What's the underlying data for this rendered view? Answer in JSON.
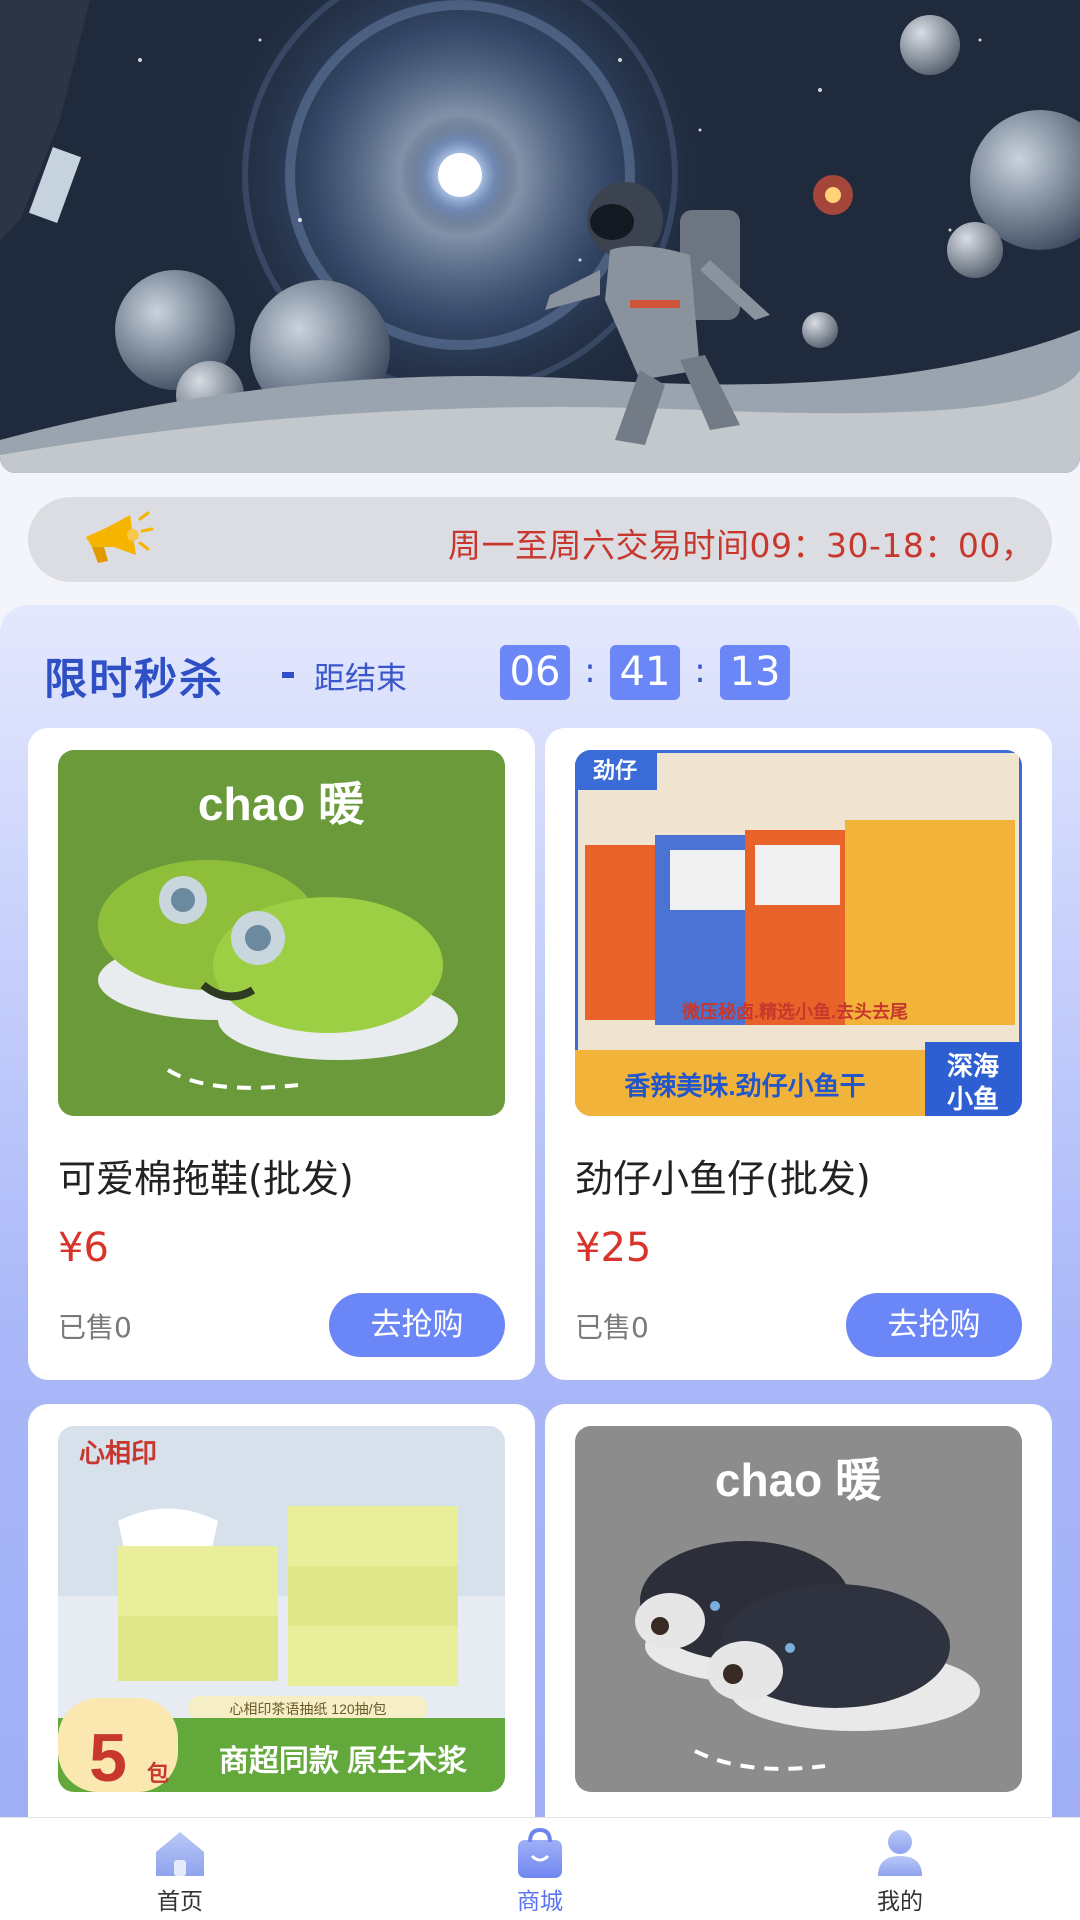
{
  "notice": {
    "text": "周一至周六交易时间09：30-18：00，",
    "speaker_icon": "megaphone-icon"
  },
  "flash_sale": {
    "title": "限时秒杀",
    "subtitle": "距结束",
    "countdown": {
      "hours": "06",
      "minutes": "41",
      "seconds": "13",
      "separator": ":"
    }
  },
  "products": [
    {
      "name": "可爱棉拖鞋(批发)",
      "price": "¥6",
      "sold": "已售0",
      "button": "去抢购",
      "image_text": {
        "brand": "chao 暖"
      }
    },
    {
      "name": "劲仔小鱼仔(批发)",
      "price": "¥25",
      "sold": "已售0",
      "button": "去抢购",
      "image_text": {
        "logo": "劲仔",
        "line1": "微压秘卤.精选小鱼.去头去尾",
        "line2": "香辣美味.劲仔小鱼干",
        "badge1": "深海",
        "badge2": "小鱼"
      }
    },
    {
      "name": "",
      "price": "",
      "sold": "",
      "button": "",
      "image_text": {
        "logo": "心相印",
        "pack": "心相印茶语抽纸 120抽/包",
        "count": "5",
        "unit": "包",
        "slogan": "商超同款 原生木浆"
      }
    },
    {
      "name": "",
      "price": "",
      "sold": "",
      "button": "",
      "image_text": {
        "brand": "chao 暖"
      }
    }
  ],
  "tabbar": {
    "items": [
      {
        "label": "首页",
        "icon": "home-icon",
        "active": false
      },
      {
        "label": "商城",
        "icon": "shopping-bag-icon",
        "active": true
      },
      {
        "label": "我的",
        "icon": "user-icon",
        "active": false
      }
    ]
  },
  "colors": {
    "accent": "#6b86f7",
    "title_blue": "#2f4fc4",
    "price_red": "#d8342b",
    "notice_red": "#c8372d",
    "active_tab": "#5b74f2"
  }
}
